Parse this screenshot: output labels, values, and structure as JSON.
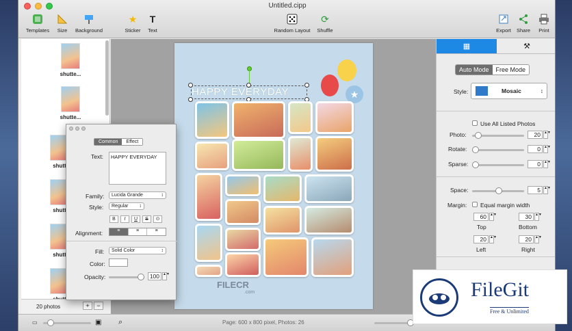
{
  "window": {
    "title": "Untitled.cipp"
  },
  "colors": {
    "accent": "#1e88e5",
    "close": "#fc605b",
    "minimize": "#fdbc40",
    "zoom": "#34c84a",
    "page_bg": "#c5daea"
  },
  "toolbar": {
    "left": [
      {
        "label": "Templates",
        "icon": "templates-icon"
      },
      {
        "label": "Size",
        "icon": "size-icon"
      },
      {
        "label": "Background",
        "icon": "background-icon"
      },
      {
        "label": "Sticker",
        "icon": "sticker-icon"
      },
      {
        "label": "Text",
        "icon": "text-icon"
      }
    ],
    "center": [
      {
        "label": "Random Layout",
        "icon": "dice-icon"
      },
      {
        "label": "Shuffle",
        "icon": "shuffle-icon"
      }
    ],
    "right": [
      {
        "label": "Export",
        "icon": "export-icon"
      },
      {
        "label": "Share",
        "icon": "share-icon"
      },
      {
        "label": "Print",
        "icon": "print-icon"
      }
    ]
  },
  "sidebar": {
    "thumbs": [
      "shutte...",
      "shutte...",
      "shutt",
      "shutt",
      "shutt",
      "shutt",
      "shutt"
    ],
    "count_label": "20 photos",
    "add_label": "+",
    "remove_label": "−"
  },
  "canvas": {
    "headline": "HAPPY EVERYDAY",
    "watermark_main": "FILECR",
    "watermark_sub": ".com"
  },
  "text_panel": {
    "tabs": [
      "Common",
      "Effect"
    ],
    "text_label": "Text:",
    "text_value": "HAPPY EVERYDAY",
    "family_label": "Family:",
    "family_value": "Lucida Grande",
    "style_label": "Style:",
    "style_value": "Regular",
    "format_buttons": [
      "B",
      "I",
      "U",
      "S",
      "⊙"
    ],
    "alignment_label": "Alignment:",
    "fill_label": "Fill:",
    "fill_value": "Solid Color",
    "color_label": "Color:",
    "opacity_label": "Opacity:",
    "opacity_value": "100",
    "opacity_fraction": 1.0
  },
  "right_panel": {
    "modes": [
      "Auto Mode",
      "Free Mode"
    ],
    "style_label": "Style:",
    "style_value": "Mosaic",
    "use_all_label": "Use All Listed Photos",
    "photo_label": "Photo:",
    "photo_value": "20",
    "rotate_label": "Rotate:",
    "rotate_value": "0",
    "sparse_label": "Sparse:",
    "sparse_value": "0",
    "space_label": "Space:",
    "space_value": "5",
    "margin_label": "Margin:",
    "equal_margin_label": "Equal margin width",
    "top_value": "60",
    "top_label": "Top",
    "bottom_value": "30",
    "bottom_label": "Bottom",
    "left_value": "20",
    "left_label": "Left",
    "right_value": "20",
    "right_label": "Right"
  },
  "status": {
    "text": "Page: 600 x 800 pixel, Photos: 26"
  },
  "badge": {
    "brand": "FileGit",
    "tagline": "Free & Unlimited"
  }
}
